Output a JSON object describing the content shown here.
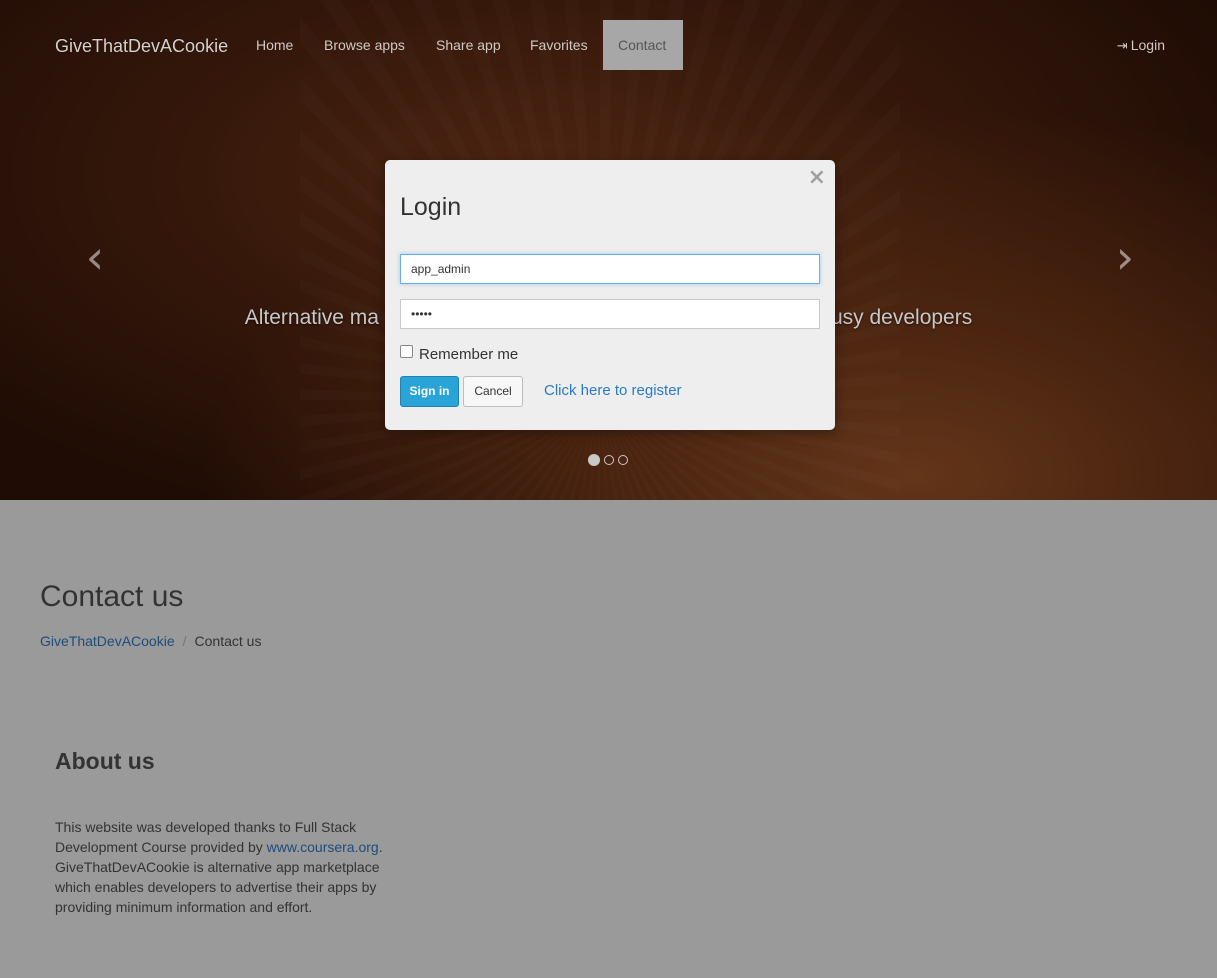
{
  "navbar": {
    "brand": "GiveThatDevACookie",
    "items": [
      {
        "label": "Home"
      },
      {
        "label": "Browse apps"
      },
      {
        "label": "Share app"
      },
      {
        "label": "Favorites"
      },
      {
        "label": "Contact",
        "active": true
      }
    ],
    "login_label": "Login"
  },
  "carousel": {
    "caption_left": "Alternative ma",
    "caption_right": "usy developers",
    "prev_glyph": "‹",
    "next_glyph": "›",
    "slides_count": 3,
    "active_slide": 1
  },
  "modal": {
    "title": "Login",
    "close_glyph": "×",
    "username_value": "app_admin",
    "password_value": "•••••",
    "remember_label": "Remember me",
    "remember_checked": false,
    "sign_in_label": "Sign in",
    "cancel_label": "Cancel",
    "register_link": "Click here to register"
  },
  "page": {
    "title": "Contact us",
    "breadcrumb": [
      {
        "label": "GiveThatDevACookie"
      },
      {
        "label": "Contact us"
      }
    ],
    "breadcrumb_separator": "/",
    "about": {
      "heading": "About us",
      "text_before_link": "This website was developed thanks to Full Stack Development Course provided by ",
      "link_text": "www.coursera.org",
      "text_after_link": ". GiveThatDevACookie is alternative app marketplace which enables developers to advertise their apps by providing minimum information and effort."
    }
  },
  "colors": {
    "accent": "#2aa3d6",
    "link": "#2a7ac4",
    "active_nav_bg": "#a7a7a7",
    "page_bg": "#9a9a9a"
  }
}
